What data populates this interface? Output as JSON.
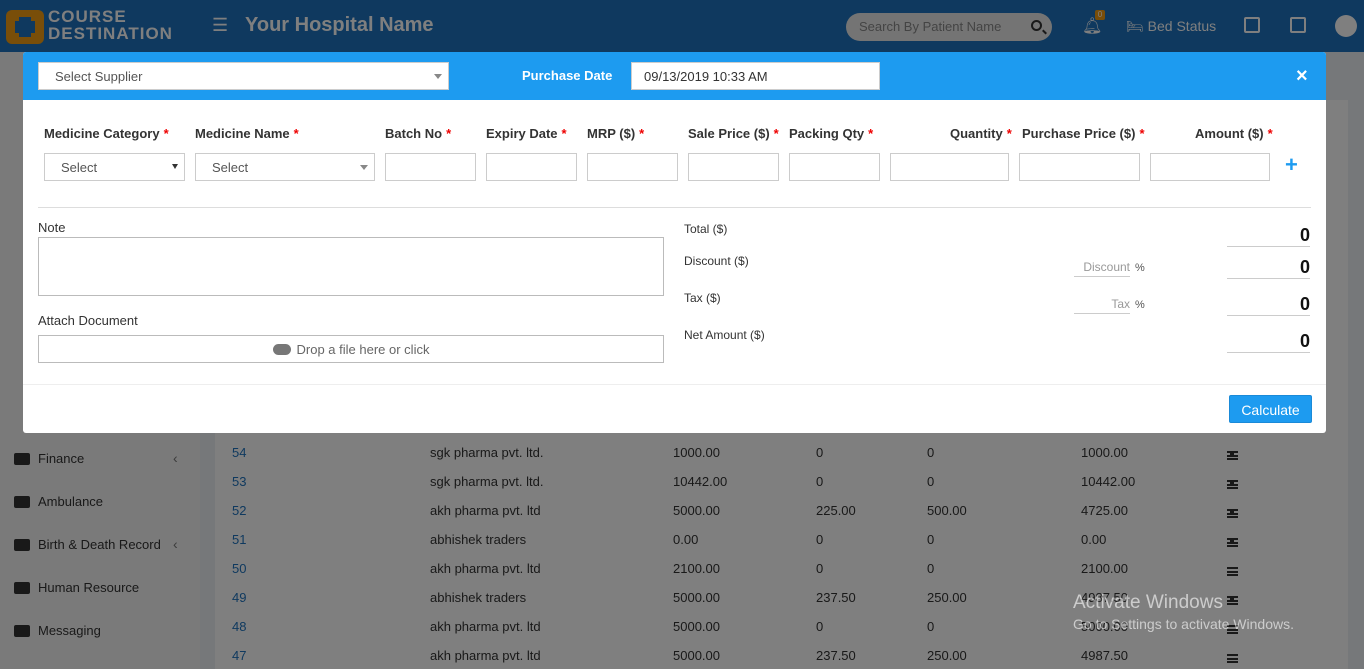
{
  "topbar": {
    "brand_line1": "COURSE",
    "brand_line2": "DESTINATION",
    "hospital_name": "Your Hospital Name",
    "search_placeholder": "Search By Patient Name",
    "notification_count": "0",
    "bed_status_label": "Bed Status"
  },
  "sidebar": {
    "items": [
      {
        "label": "Finance",
        "has_chevron": true,
        "icon": "money-icon"
      },
      {
        "label": "Ambulance",
        "has_chevron": false,
        "icon": "ambulance-icon"
      },
      {
        "label": "Birth & Death Record",
        "has_chevron": true,
        "icon": "birthday-cake-icon"
      },
      {
        "label": "Human Resource",
        "has_chevron": false,
        "icon": "sitemap-icon"
      },
      {
        "label": "Messaging",
        "has_chevron": false,
        "icon": "bullhorn-icon"
      }
    ]
  },
  "table": {
    "rows": [
      {
        "id": "54",
        "supplier": "sgk pharma pvt. ltd.",
        "total": "1000.00",
        "discount": "0",
        "tax": "0",
        "net": "1000.00",
        "download": true
      },
      {
        "id": "53",
        "supplier": "sgk pharma pvt. ltd.",
        "total": "10442.00",
        "discount": "0",
        "tax": "0",
        "net": "10442.00",
        "download": true
      },
      {
        "id": "52",
        "supplier": "akh pharma pvt. ltd",
        "total": "5000.00",
        "discount": "225.00",
        "tax": "500.00",
        "net": "4725.00",
        "download": true
      },
      {
        "id": "51",
        "supplier": "abhishek traders",
        "total": "0.00",
        "discount": "0",
        "tax": "0",
        "net": "0.00",
        "download": true
      },
      {
        "id": "50",
        "supplier": "akh pharma pvt. ltd",
        "total": "2100.00",
        "discount": "0",
        "tax": "0",
        "net": "2100.00",
        "download": false
      },
      {
        "id": "49",
        "supplier": "abhishek traders",
        "total": "5000.00",
        "discount": "237.50",
        "tax": "250.00",
        "net": "4987.50",
        "download": true
      },
      {
        "id": "48",
        "supplier": "akh pharma pvt. ltd",
        "total": "5000.00",
        "discount": "0",
        "tax": "0",
        "net": "5000.00",
        "download": false
      },
      {
        "id": "47",
        "supplier": "akh pharma pvt. ltd",
        "total": "5000.00",
        "discount": "237.50",
        "tax": "250.00",
        "net": "4987.50",
        "download": false
      }
    ]
  },
  "watermark": {
    "line1": "Activate Windows",
    "line2": "Go to Settings to activate Windows."
  },
  "modal": {
    "supplier_select": "Select Supplier",
    "purchase_date_label": "Purchase Date",
    "purchase_date_value": "09/13/2019 10:33 AM",
    "close_symbol": "×",
    "columns": {
      "medicine_category": "Medicine Category",
      "medicine_name": "Medicine Name",
      "batch_no": "Batch No",
      "expiry_date": "Expiry Date",
      "mrp": "MRP ($)",
      "sale_price": "Sale Price ($)",
      "packing_qty": "Packing Qty",
      "quantity": "Quantity",
      "purchase_price": "Purchase Price ($)",
      "amount": "Amount ($)"
    },
    "required_mark": "*",
    "category_select": "Select",
    "name_select": "Select",
    "add_row_symbol": "+",
    "note_label": "Note",
    "attach_label": "Attach Document",
    "dropzone_text": "Drop a file here or click",
    "summary": {
      "total_label": "Total ($)",
      "discount_label": "Discount ($)",
      "tax_label": "Tax ($)",
      "net_label": "Net Amount ($)",
      "discount_placeholder": "Discount",
      "tax_placeholder": "Tax",
      "percent": "%",
      "total_value": "0",
      "discount_value": "0",
      "tax_value": "0",
      "net_value": "0"
    },
    "calculate_label": "Calculate"
  },
  "colors": {
    "topbar": "#1e73be",
    "modal_header": "#1d9bf0",
    "brand_orange": "#f39c12",
    "required": "#e00000"
  }
}
